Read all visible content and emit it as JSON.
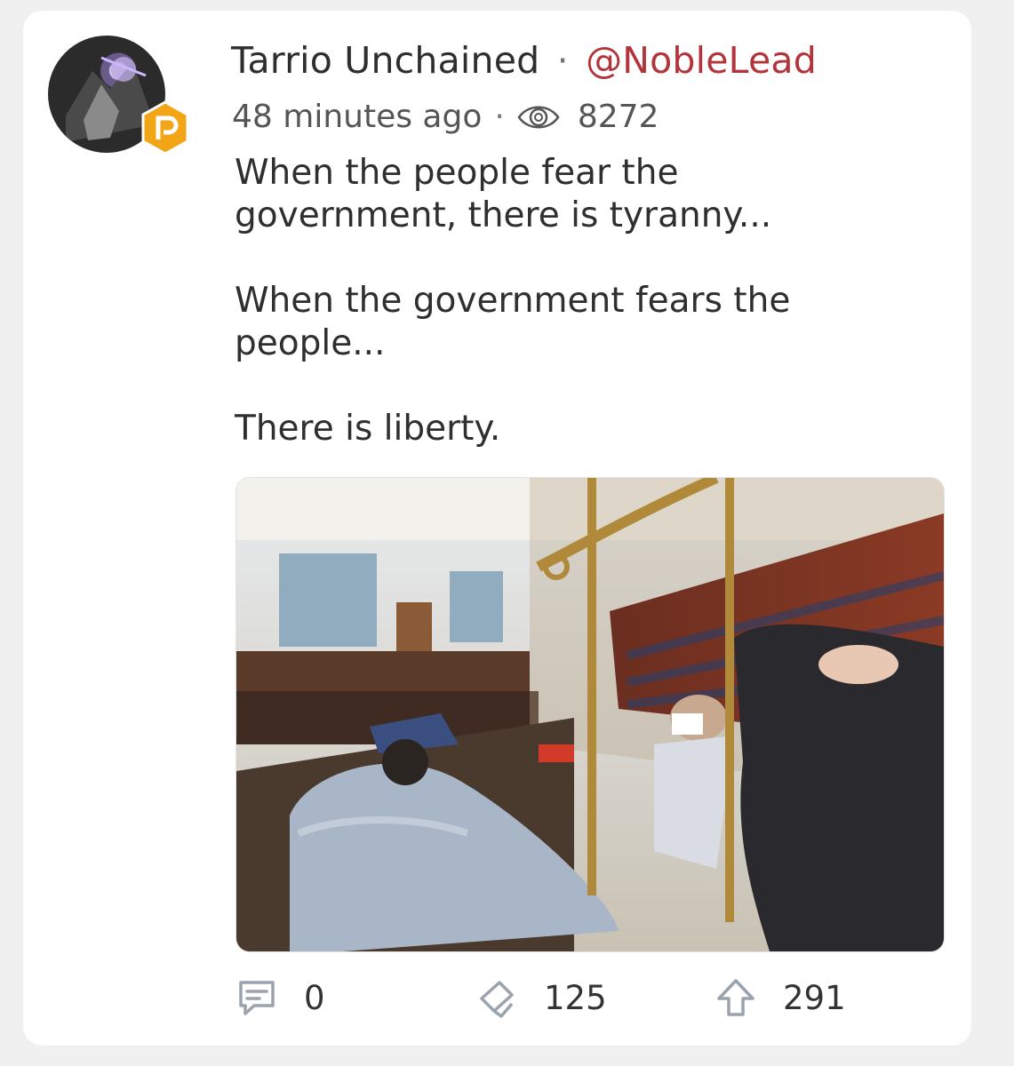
{
  "post": {
    "author_name": "Tarrio Unchained",
    "separator": "·",
    "handle": "@NobleLead",
    "time_ago": "48 minutes ago",
    "views": "8272",
    "text": "When the people fear the\ngovernment, there is tyranny...\n\nWhen the government fears the\npeople...\n\nThere is liberty."
  },
  "actions": {
    "comments": "0",
    "echoes": "125",
    "upvotes": "291"
  },
  "icons": {
    "views": "eye-icon",
    "comments": "comment-icon",
    "echoes": "echo-icon",
    "upvotes": "upvote-icon",
    "badge": "parler-badge-icon"
  },
  "colors": {
    "handle": "#b2353b",
    "badge": "#f2a516",
    "text": "#2f2f2f",
    "icon": "#9aa3ad"
  }
}
